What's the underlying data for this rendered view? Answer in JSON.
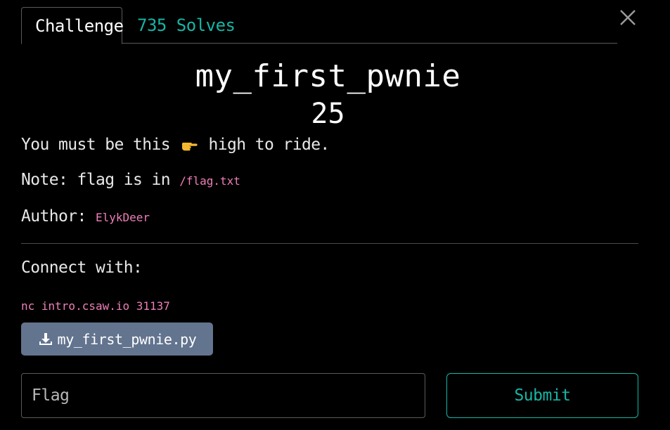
{
  "tabs": {
    "challenge": "Challenge",
    "solves": "735 Solves"
  },
  "challenge": {
    "name": "my_first_pwnie",
    "points": "25"
  },
  "description": {
    "line1_before": "You must be this",
    "line1_emoji": "pointing-hand-icon",
    "line1_after": "high to ride.",
    "line2_label": "Note: flag is in",
    "line2_code": "/flag.txt",
    "line3_label": "Author:",
    "line3_code": "ElykDeer"
  },
  "connect": {
    "label": "Connect with:",
    "command": "nc intro.csaw.io 31137"
  },
  "file": {
    "name": "my_first_pwnie.py",
    "icon": "download-icon"
  },
  "form": {
    "flag_placeholder": "Flag",
    "submit_label": "Submit"
  },
  "colors": {
    "accent": "#16b5a6",
    "code": "#ee7fb8",
    "file_button": "#63748f",
    "background": "#000000"
  }
}
